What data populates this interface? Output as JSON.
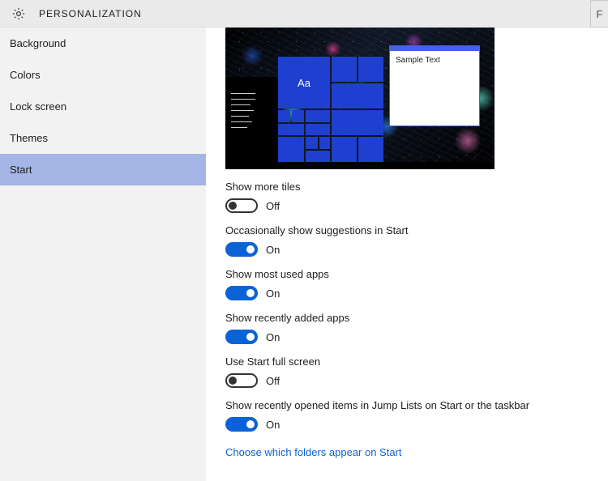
{
  "header": {
    "title": "PERSONALIZATION",
    "right_char": "F"
  },
  "sidebar": {
    "items": [
      {
        "label": "Background",
        "selected": false
      },
      {
        "label": "Colors",
        "selected": false
      },
      {
        "label": "Lock screen",
        "selected": false
      },
      {
        "label": "Themes",
        "selected": false
      },
      {
        "label": "Start",
        "selected": true
      }
    ]
  },
  "preview": {
    "tile_text": "Aa",
    "sample_window_text": "Sample Text"
  },
  "settings": [
    {
      "label": "Show more tiles",
      "on": false
    },
    {
      "label": "Occasionally show suggestions in Start",
      "on": true
    },
    {
      "label": "Show most used apps",
      "on": true
    },
    {
      "label": "Show recently added apps",
      "on": true
    },
    {
      "label": "Use Start full screen",
      "on": false
    },
    {
      "label": "Show recently opened items in Jump Lists on Start or the taskbar",
      "on": true
    }
  ],
  "toggle_text": {
    "on": "On",
    "off": "Off"
  },
  "link": {
    "choose_folders": "Choose which folders appear on Start"
  }
}
